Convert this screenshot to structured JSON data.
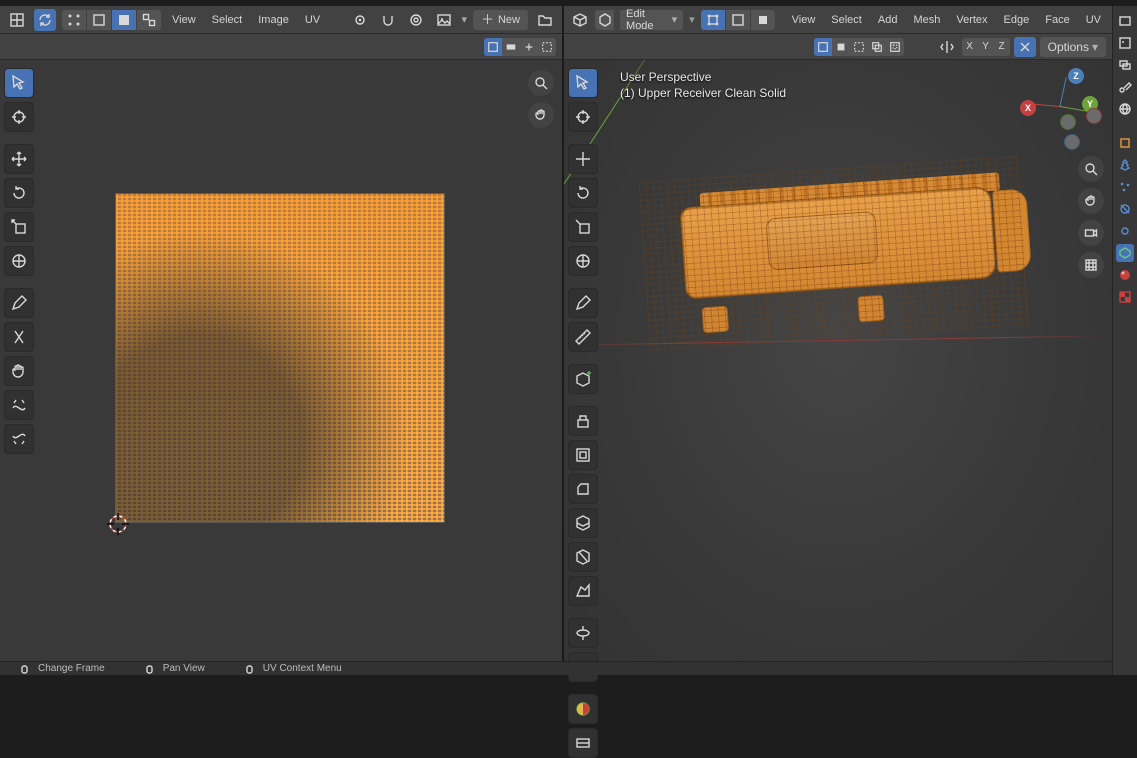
{
  "left_header": {
    "menus": {
      "view": "View",
      "select": "Select",
      "image": "Image",
      "uv": "UV"
    },
    "new_label": "New",
    "open_label": "Open"
  },
  "right_header": {
    "mode_label": "Edit Mode",
    "menus": {
      "view": "View",
      "select": "Select",
      "add": "Add",
      "mesh": "Mesh",
      "vertex": "Vertex",
      "edge": "Edge",
      "face": "Face",
      "uv": "UV"
    }
  },
  "right_subheader": {
    "axes": {
      "x": "X",
      "y": "Y",
      "z": "Z"
    },
    "options_label": "Options"
  },
  "overlay": {
    "line1": "User Perspective",
    "line2": "(1) Upper Receiver Clean Solid"
  },
  "gizmo": {
    "x": "X",
    "y": "Y",
    "z": "Z"
  },
  "tools_left": [
    "select-box",
    "cursor",
    "move",
    "rotate",
    "scale",
    "transform",
    "annotate",
    "measure"
  ],
  "tools_right": [
    "select-box",
    "cursor",
    "move",
    "rotate",
    "scale",
    "transform",
    "annotate",
    "measure",
    "extrude",
    "inset",
    "bevel",
    "loop-cut",
    "knife",
    "poly-build",
    "spin",
    "smooth",
    "edge-slide",
    "shrink-fatten",
    "rip"
  ],
  "statusbar": {
    "a": "Change Frame",
    "b": "Pan View",
    "c": "UV Context Menu"
  },
  "colors": {
    "accent": "#4772b3",
    "orange": "#ee8b24"
  }
}
